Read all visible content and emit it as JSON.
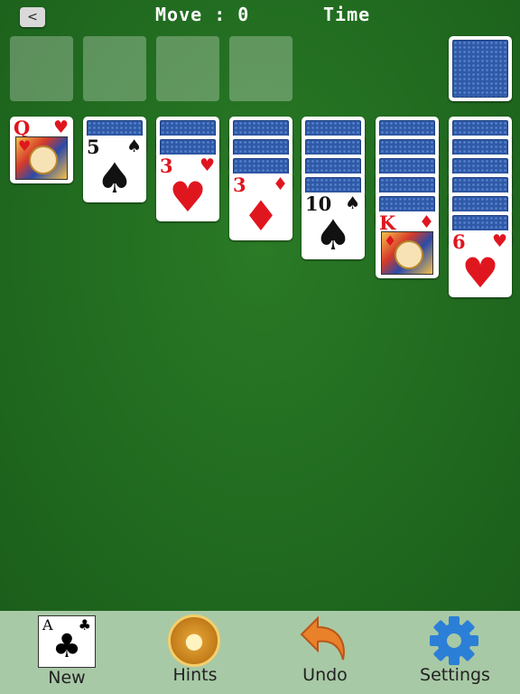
{
  "header": {
    "back_label": "<",
    "move_text": "Move : 0",
    "time_text": "Time"
  },
  "cards": {
    "col1_top": {
      "rank": "Q",
      "suit": "♥"
    },
    "col2_top": {
      "rank": "5",
      "suit": "♠"
    },
    "col3_top": {
      "rank": "3",
      "suit": "♥"
    },
    "col4_top": {
      "rank": "3",
      "suit": "♦"
    },
    "col5_top": {
      "rank": "10",
      "suit": "♠"
    },
    "col6_top": {
      "rank": "K",
      "suit": "♦"
    },
    "col7_top": {
      "rank": "6",
      "suit": "♥"
    }
  },
  "tableau_face_down_counts": [
    0,
    1,
    2,
    3,
    4,
    5,
    6
  ],
  "toolbar": {
    "new_label": "New",
    "new_icon_rank": "A",
    "new_icon_suit": "♣",
    "hints_label": "Hints",
    "undo_label": "Undo",
    "settings_label": "Settings"
  },
  "colors": {
    "felt": "#216b20",
    "toolbar": "#a8c9a6",
    "card_back": "#2f5aa8",
    "red_suit": "#e0161f"
  },
  "icons": {
    "back": "chevron-left-icon",
    "hints": "lightbulb-icon",
    "undo": "undo-arrow-icon",
    "settings": "gear-icon"
  }
}
